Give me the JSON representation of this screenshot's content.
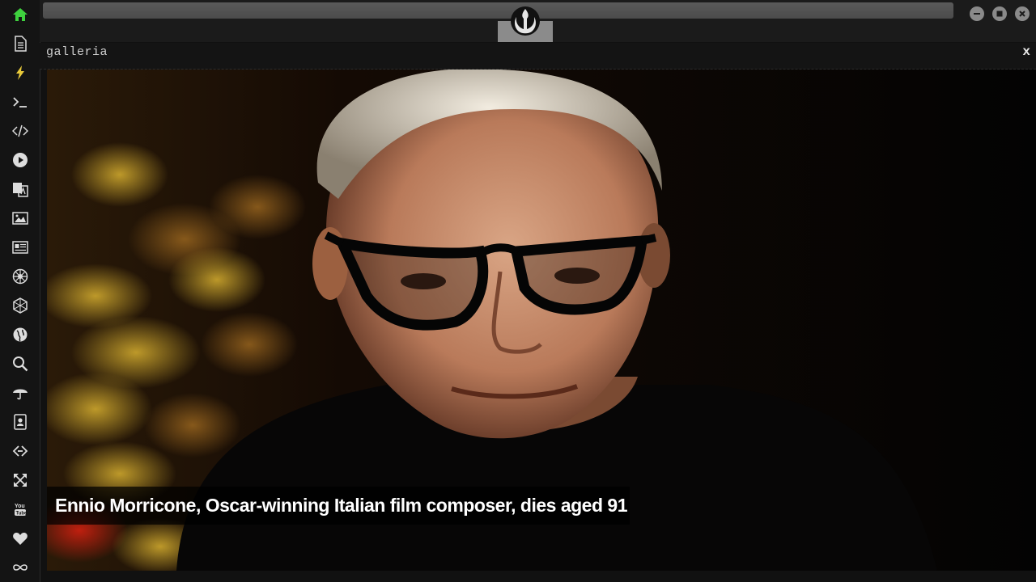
{
  "sidebar": {
    "items": [
      {
        "icon": "home-icon",
        "color": "#3ed13e"
      },
      {
        "icon": "document-icon",
        "color": "#dddddd"
      },
      {
        "icon": "lightning-icon",
        "color": "#e8c93a"
      },
      {
        "icon": "terminal-icon",
        "color": "#dddddd"
      },
      {
        "icon": "code-icon",
        "color": "#dddddd"
      },
      {
        "icon": "play-icon",
        "color": "#dddddd"
      },
      {
        "icon": "translate-icon",
        "color": "#dddddd"
      },
      {
        "icon": "image-icon",
        "color": "#dddddd"
      },
      {
        "icon": "news-icon",
        "color": "#dddddd"
      },
      {
        "icon": "rebel-icon",
        "color": "#dddddd"
      },
      {
        "icon": "empire-icon",
        "color": "#dddddd"
      },
      {
        "icon": "globe-icon",
        "color": "#dddddd"
      },
      {
        "icon": "search-icon",
        "color": "#dddddd"
      },
      {
        "icon": "umbrella-icon",
        "color": "#dddddd"
      },
      {
        "icon": "contacts-icon",
        "color": "#dddddd"
      },
      {
        "icon": "chain-code-icon",
        "color": "#dddddd"
      },
      {
        "icon": "expand-icon",
        "color": "#dddddd"
      },
      {
        "icon": "youtube-icon",
        "color": "#dddddd"
      },
      {
        "icon": "heart-icon",
        "color": "#dddddd"
      },
      {
        "icon": "infinity-icon",
        "color": "#dddddd"
      }
    ]
  },
  "topbar": {
    "logo": "rebel-alliance-icon",
    "window_controls": [
      "minimize-icon",
      "maximize-icon",
      "close-icon"
    ]
  },
  "panel": {
    "title": "galleria",
    "close_label": "x"
  },
  "gallery": {
    "caption": "Ennio Morricone, Oscar-winning Italian film composer, dies aged 91"
  }
}
